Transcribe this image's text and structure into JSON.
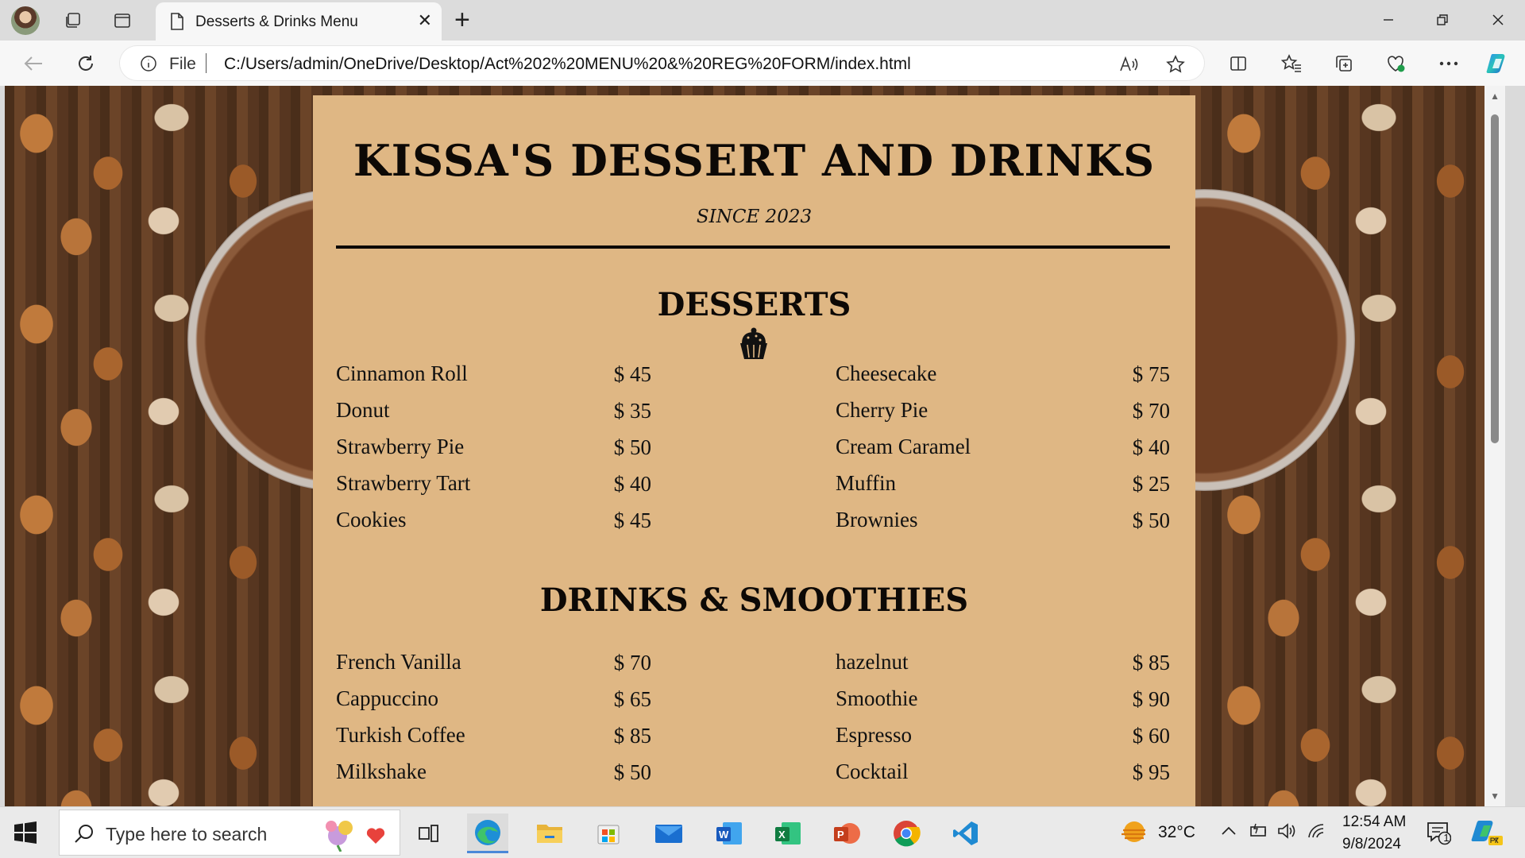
{
  "browser": {
    "tab_title": "Desserts & Drinks Menu",
    "new_tab_symbol": "+",
    "close_symbol": "✕",
    "file_label": "File",
    "url": "C:/Users/admin/OneDrive/Desktop/Act%202%20MENU%20&%20REG%20FORM/index.html"
  },
  "menu": {
    "title": "KISSA'S DESSERT AND DRINKS",
    "since": "SINCE 2023",
    "desserts_heading": "DESSERTS",
    "drinks_heading": "DRINKS & SMOOTHIES",
    "desserts": [
      {
        "name": "Cinnamon Roll",
        "price": "$ 45"
      },
      {
        "name": "Donut",
        "price": "$ 35"
      },
      {
        "name": "Strawberry Pie",
        "price": "$ 50"
      },
      {
        "name": "Strawberry Tart",
        "price": "$ 40"
      },
      {
        "name": "Cookies",
        "price": "$ 45"
      },
      {
        "name": "Cheesecake",
        "price": "$ 75"
      },
      {
        "name": "Cherry Pie",
        "price": "$ 70"
      },
      {
        "name": "Cream Caramel",
        "price": "$ 40"
      },
      {
        "name": "Muffin",
        "price": "$ 25"
      },
      {
        "name": "Brownies",
        "price": "$ 50"
      }
    ],
    "drinks": [
      {
        "name": "French Vanilla",
        "price": "$ 70"
      },
      {
        "name": "Cappuccino",
        "price": "$ 65"
      },
      {
        "name": "Turkish Coffee",
        "price": "$ 85"
      },
      {
        "name": "Milkshake",
        "price": "$ 50"
      },
      {
        "name": "hazelnut",
        "price": "$ 85"
      },
      {
        "name": "Smoothie",
        "price": "$ 90"
      },
      {
        "name": "Espresso",
        "price": "$ 60"
      },
      {
        "name": "Cocktail",
        "price": "$ 95"
      }
    ]
  },
  "taskbar": {
    "search_placeholder": "Type here to search",
    "temperature": "32°C",
    "time": "12:54 AM",
    "date": "9/8/2024",
    "notification_count": "1"
  },
  "icons": {
    "tab": "page-icon",
    "omnibox_left": "info-icon",
    "omnibox_right": [
      "read-aloud-icon",
      "favorite-star-icon"
    ],
    "toolbar": [
      "split-screen-icon",
      "favorites-icon",
      "collections-icon",
      "browser-essentials-icon",
      "more-icon",
      "copilot-icon"
    ],
    "taskbar_apps": [
      "task-view-icon",
      "edge-icon",
      "file-explorer-icon",
      "store-icon",
      "mail-icon",
      "word-icon",
      "excel-icon",
      "powerpoint-icon",
      "chrome-icon",
      "vscode-icon"
    ]
  },
  "colors": {
    "menu_card": "#dfb784",
    "menu_text": "#0d0906",
    "taskbar": "#eaeaea"
  }
}
